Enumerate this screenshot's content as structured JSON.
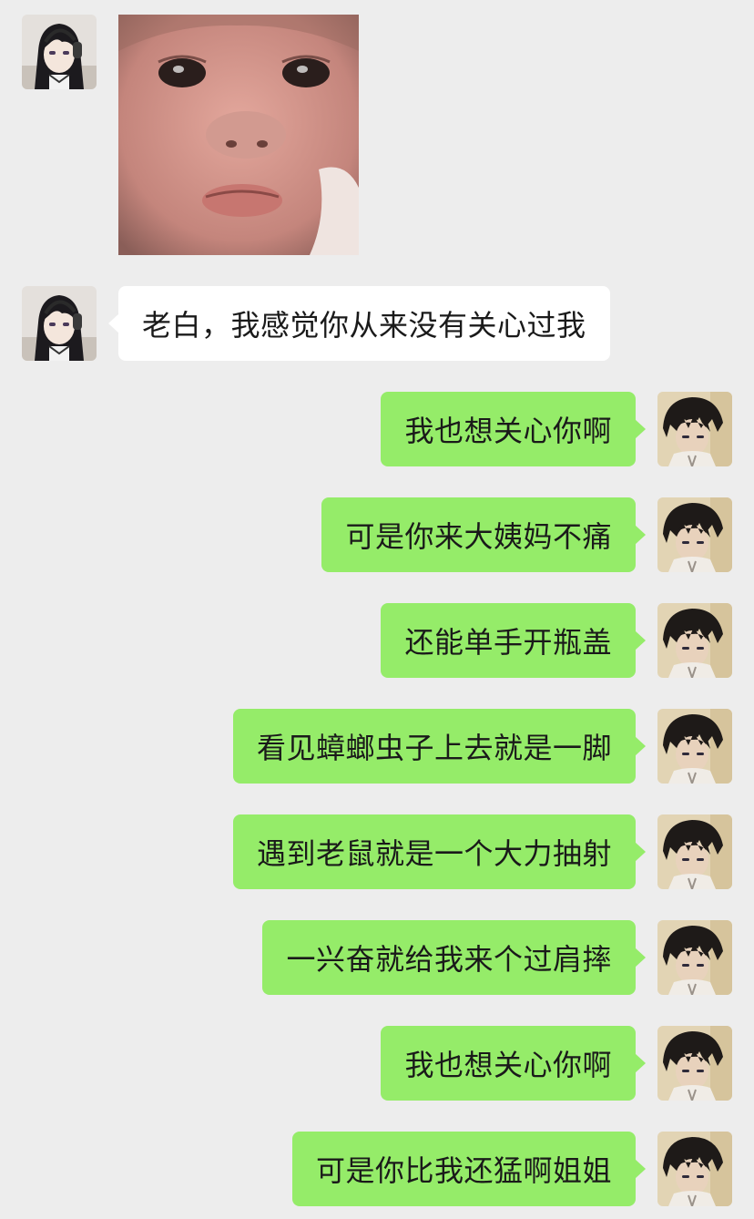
{
  "chat": {
    "incoming_message": "老白，我感觉你从来没有关心过我",
    "outgoing_messages": [
      "我也想关心你啊",
      "可是你来大姨妈不痛",
      "还能单手开瓶盖",
      "看见蟑螂虫子上去就是一脚",
      "遇到老鼠就是一个大力抽射",
      "一兴奋就给我来个过肩摔",
      "我也想关心你啊",
      "可是你比我还猛啊姐姐"
    ]
  },
  "colors": {
    "background": "#ededed",
    "incoming_bubble": "#ffffff",
    "outgoing_bubble": "#95ec69",
    "text": "#1a1a1a"
  },
  "icons": {
    "contact_avatar": "anime-girl-headphones-avatar",
    "self_avatar": "anime-boy-avatar",
    "sticker": "pouting-baby-sticker"
  }
}
